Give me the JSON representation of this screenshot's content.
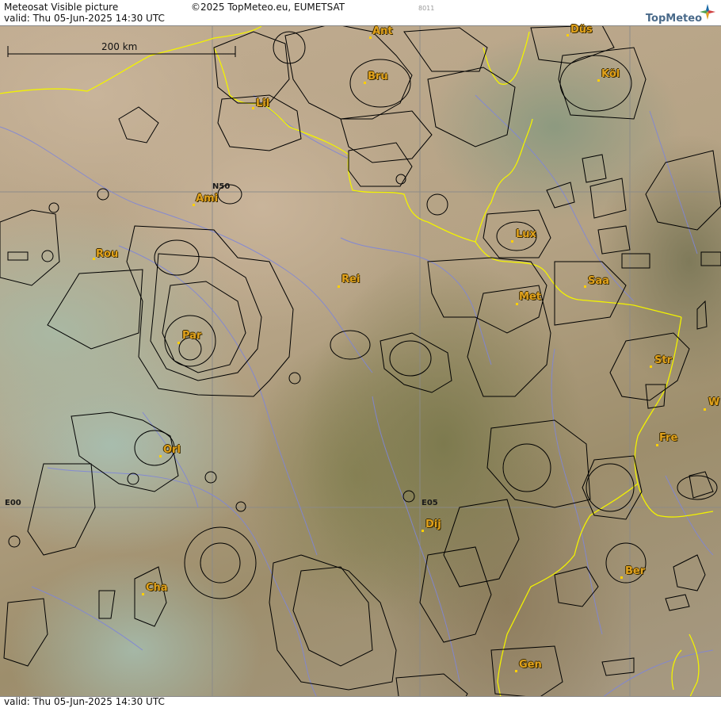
{
  "header": {
    "title": "Meteosat Visible picture",
    "copyright": "©2025 TopMeteo.eu, EUMETSAT",
    "code": "8011",
    "valid_top": "valid:  Thu  05-Jun-2025  14:30 UTC",
    "valid_bottom": "valid:  Thu  05-Jun-2025  14:30 UTC",
    "logo_text": "TopMeteo"
  },
  "scale": {
    "label": "200 km"
  },
  "grid_labels": {
    "n50": "N50",
    "e00": "E00",
    "e05": "E05"
  },
  "cities": [
    {
      "id": "ant",
      "name": "Ant"
    },
    {
      "id": "dus",
      "name": "Düs"
    },
    {
      "id": "bru",
      "name": "Bru"
    },
    {
      "id": "kol",
      "name": "Köl"
    },
    {
      "id": "lil",
      "name": "Lil"
    },
    {
      "id": "ami",
      "name": "Ami"
    },
    {
      "id": "rou",
      "name": "Rou"
    },
    {
      "id": "lux",
      "name": "Lux"
    },
    {
      "id": "rei",
      "name": "Rei"
    },
    {
      "id": "saa",
      "name": "Saa"
    },
    {
      "id": "met",
      "name": "Met"
    },
    {
      "id": "par",
      "name": "Par"
    },
    {
      "id": "str",
      "name": "Str"
    },
    {
      "id": "w",
      "name": "W"
    },
    {
      "id": "fre",
      "name": "Fre"
    },
    {
      "id": "orl",
      "name": "Orl"
    },
    {
      "id": "dij",
      "name": "Dij"
    },
    {
      "id": "ber",
      "name": "Ber"
    },
    {
      "id": "cha",
      "name": "Cha"
    },
    {
      "id": "gen",
      "name": "Gen"
    }
  ],
  "colors": {
    "border": "#f2f200",
    "rivers": "#7f86d8",
    "airspace": "#000000",
    "grid": "#8a8a8a",
    "city_label": "#e1a21c"
  }
}
